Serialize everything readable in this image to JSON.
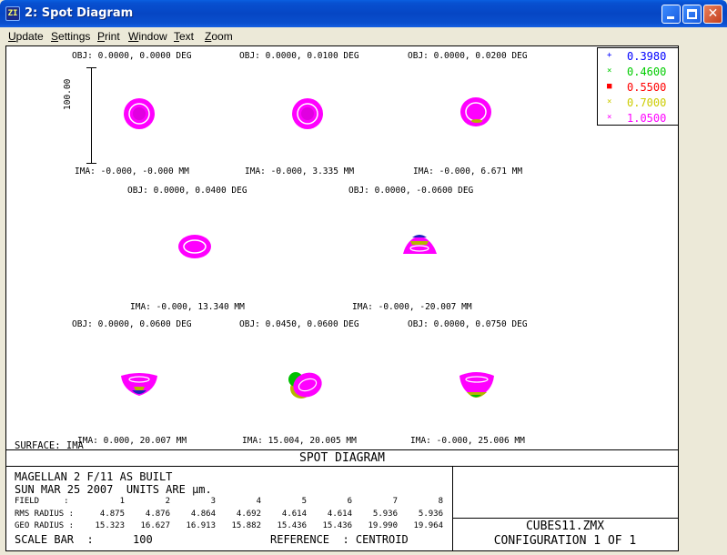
{
  "window": {
    "title": "2: Spot Diagram",
    "icon": "zemax-app-icon",
    "icon_text": "ZI"
  },
  "menu": [
    {
      "label": "Update",
      "u": "U",
      "rest": "pdate"
    },
    {
      "label": "Settings",
      "u": "S",
      "rest": "ettings"
    },
    {
      "label": "Print",
      "u": "P",
      "rest": "rint"
    },
    {
      "label": "Window",
      "u": "W",
      "rest": "indow"
    },
    {
      "label": "Text",
      "u": "T",
      "rest": "ext"
    },
    {
      "label": "Zoom",
      "u": "Z",
      "rest": "oom"
    }
  ],
  "legend": [
    {
      "marker": "+",
      "wavelength": "0.3980",
      "color": "#0000ff"
    },
    {
      "marker": "×",
      "wavelength": "0.4600",
      "color": "#00cc00"
    },
    {
      "marker": "■",
      "wavelength": "0.5500",
      "color": "#ff0000"
    },
    {
      "marker": "×",
      "wavelength": "0.7000",
      "color": "#cccc00"
    },
    {
      "marker": "×",
      "wavelength": "1.0500",
      "color": "#ff00ff"
    }
  ],
  "scale_bar_label": "100.00",
  "fields": [
    {
      "obj": "OBJ: 0.0000, 0.0000 DEG",
      "ima": "IMA: -0.000, -0.000 MM",
      "shape": "round"
    },
    {
      "obj": "OBJ: 0.0000, 0.0100 DEG",
      "ima": "IMA: -0.000, 3.335 MM",
      "shape": "round"
    },
    {
      "obj": "OBJ: 0.0000, 0.0200 DEG",
      "ima": "IMA: -0.000, 6.671 MM",
      "shape": "round-yellow"
    },
    {
      "obj": "OBJ: 0.0000, 0.0400 DEG",
      "ima": "IMA: -0.000, 13.340 MM",
      "shape": "oval"
    },
    {
      "obj": "OBJ: 0.0000, -0.0600 DEG",
      "ima": "IMA: -0.000, -20.007 MM",
      "shape": "cap-up"
    },
    {
      "obj": "OBJ: 0.0000, 0.0600 DEG",
      "ima": "IMA: 0.000, 20.007 MM",
      "shape": "cap-down"
    },
    {
      "obj": "OBJ: 0.0450, 0.0600 DEG",
      "ima": "IMA: 15.004, 20.005 MM",
      "shape": "tilted"
    },
    {
      "obj": "OBJ: 0.0000, 0.0750 DEG",
      "ima": "IMA: -0.000, 25.006 MM",
      "shape": "cap-down-yellow"
    }
  ],
  "surface_label": "SURFACE: IMA",
  "panel": {
    "heading": "SPOT DIAGRAM",
    "line1": "MAGELLAN 2 F/11 AS BUILT",
    "line2": "SUN MAR 25 2007  UNITS ARE µm.",
    "field_label": "FIELD     :",
    "rms_label": "RMS RADIUS :",
    "geo_label": "GEO RADIUS :",
    "field_numbers": [
      "1",
      "2",
      "3",
      "4",
      "5",
      "6",
      "7",
      "8"
    ],
    "rms_values": [
      "4.875",
      "4.876",
      "4.864",
      "4.692",
      "4.614",
      "4.614",
      "5.936",
      "5.936"
    ],
    "geo_values": [
      "15.323",
      "16.627",
      "16.913",
      "15.882",
      "15.436",
      "15.436",
      "19.990",
      "19.964"
    ],
    "scale_bar_text": "SCALE BAR  :      100",
    "reference_text": "REFERENCE  : CENTROID",
    "filename": "CUBES11.ZMX",
    "configuration": "CONFIGURATION 1 OF 1"
  }
}
